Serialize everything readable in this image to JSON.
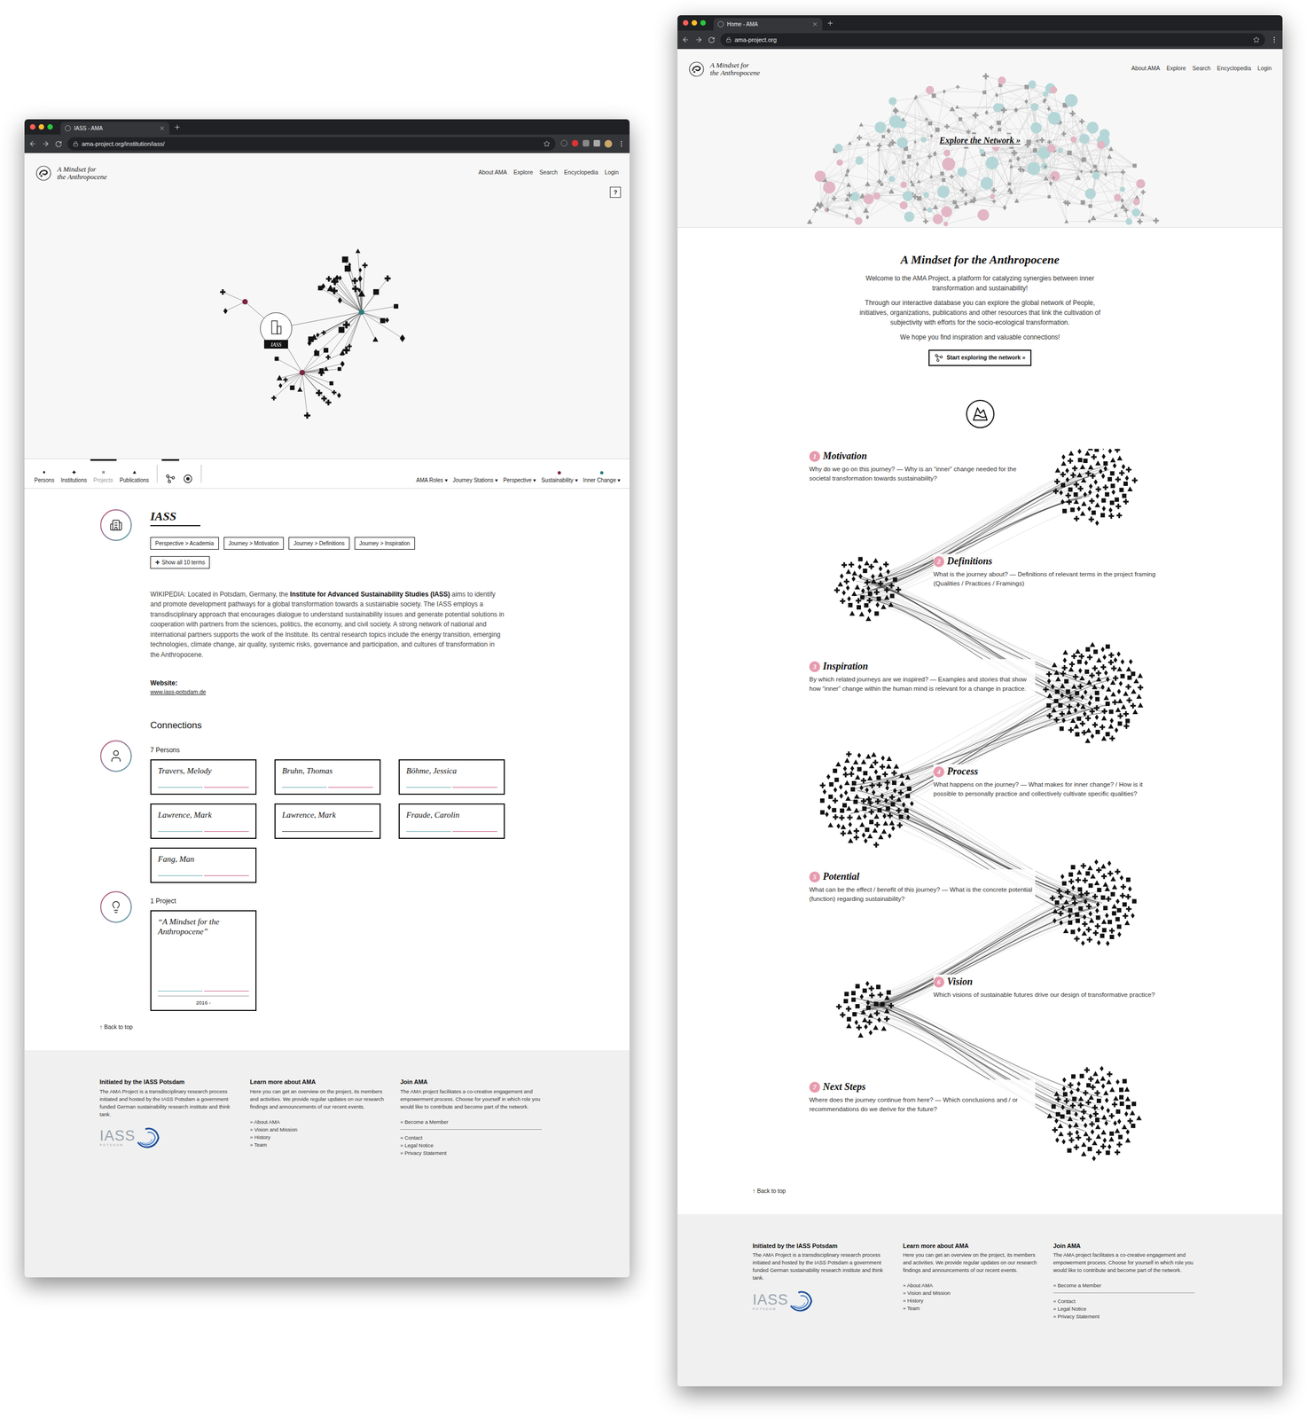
{
  "site": {
    "logo_lines": [
      "A Mindset for",
      "the Anthropocene"
    ],
    "nav": [
      "About AMA",
      "Explore",
      "Search",
      "Encyclopedia",
      "Login"
    ],
    "back_to_top": "↑ Back to top",
    "footer": {
      "columns": [
        {
          "heading": "Initiated by the IASS Potsdam",
          "text": "The AMA Project is a transdisciplinary research process initiated and hosted by the IASS Potsdam a government funded German sustainability research institute and think tank.",
          "links": [],
          "links_after_rule": []
        },
        {
          "heading": "Learn more about AMA",
          "text": "Here you can get an overview on the project, its members and activities. We provide regular updates on our research findings and announcements of our recent events.",
          "links": [
            "» About AMA",
            "» Vision and Mission",
            "» History",
            "» Team"
          ],
          "links_after_rule": []
        },
        {
          "heading": "Join AMA",
          "text": "The AMA project facilitates a co-creative engagement and empowerment process. Choose for yourself in which role you would like to contribute and become part of the network.",
          "links": [
            "» Become a Member"
          ],
          "links_after_rule": [
            "» Contact",
            "» Legal Notice",
            "» Privacy Statement"
          ]
        }
      ],
      "logo": {
        "name": "IASS",
        "sub": "POTSDAM"
      }
    }
  },
  "institution_window": {
    "tab_title": "IASS - AMA",
    "url": "ama-project.org/institution/iass/",
    "help_button": "?",
    "graph": {
      "center_label": "IASS"
    },
    "filters": [
      {
        "label": "Persons",
        "selected": false
      },
      {
        "label": "Institutions",
        "selected": false
      },
      {
        "label": "Projects",
        "selected": true
      },
      {
        "label": "Publications",
        "selected": false
      }
    ],
    "view_toggles": [
      {
        "selected": true
      },
      {
        "selected": false
      }
    ],
    "dropdowns": [
      {
        "label": "AMA Roles"
      },
      {
        "label": "Journey Stations"
      },
      {
        "label": "Perspective"
      },
      {
        "label": "Sustainability",
        "color": "#7a2342"
      },
      {
        "label": "Inner Change",
        "color": "#2b7b7e"
      }
    ],
    "caret": "▾",
    "title": "IASS",
    "tags": [
      "Perspective > Academia",
      "Journey > Motivation",
      "Journey > Definitions",
      "Journey > Inspiration"
    ],
    "show_all": {
      "icon": "✚",
      "label": "Show all 10 terms"
    },
    "description": {
      "before": "WIKIPEDIA: Located in Potsdam, Germany, the ",
      "bold": "Institute for Advanced Sustainability Studies (IASS)",
      "after": " aims to identify and promote development pathways for a global transformation towards a sustainable society. The IASS employs a transdisciplinary approach that encourages dialogue to understand sustainability issues and generate potential solutions in cooperation with partners from the sciences, politics, the economy, and civil society. A strong network of national and international partners supports the work of the Institute. Its central research topics include the energy transition, emerging technologies, climate change, air quality, systemic risks, governance and participation, and cultures of transformation in the Anthropocene."
    },
    "website": {
      "label": "Website:",
      "url": "www.iass-potsdam.de"
    },
    "connections_heading": "Connections",
    "persons": {
      "count_label": "7 Persons",
      "items": [
        {
          "name": "Travers, Melody",
          "lines": [
            "#5fa8ae",
            "#c8557f"
          ]
        },
        {
          "name": "Bruhn, Thomas",
          "lines": [
            "#5fa8ae",
            "#c8557f"
          ]
        },
        {
          "name": "Böhme, Jessica",
          "lines": [
            "#5fa8ae",
            "#c8557f"
          ]
        },
        {
          "name": "Lawrence, Mark",
          "lines": [
            "#5fa8ae",
            "#c8557f"
          ]
        },
        {
          "name": "Lawrence, Mark",
          "lines": [
            "#222222"
          ]
        },
        {
          "name": "Fraude, Carolin",
          "lines": [
            "#5fa8ae",
            "#c8557f"
          ]
        },
        {
          "name": "Fang, Man",
          "lines": [
            "#5fa8ae",
            "#c8557f"
          ]
        }
      ]
    },
    "projects": {
      "count_label": "1 Project",
      "items": [
        {
          "title": "“A Mindset for the Anthropocene”",
          "years": "2016 -",
          "lines": [
            "#5fa8ae",
            "#c8557f"
          ]
        }
      ]
    }
  },
  "home_window": {
    "tab_title": "Home - AMA",
    "url": "ama-project.org",
    "hero_link": "Explore the Network »",
    "title": "A Mindset for the Anthropocene",
    "paragraphs": [
      "Welcome to the AMA Project, a platform for catalyzing synergies between inner transformation and sustainability!",
      "Through our interactive database you can explore the global network of People, initiatives, organizations, publications and other resources that link the cultivation of subjectivity with efforts for the socio-ecological transformation.",
      "We hope you find inspiration and valuable connections!"
    ],
    "cta": "Start exploring the network »",
    "stations": [
      {
        "number": "1",
        "title": "Motivation",
        "text": "Why do we go on this journey? — Why is an “inner” change needed for the societal transformation towards sustainability?"
      },
      {
        "number": "2",
        "title": "Definitions",
        "text": "What is the journey about? — Definitions of relevant terms in the project framing (Qualities / Practices / Framings)"
      },
      {
        "number": "3",
        "title": "Inspiration",
        "text": "By which related journeys are we inspired? — Examples and stories that show how “inner” change within the human mind is relevant for a change in practice."
      },
      {
        "number": "4",
        "title": "Process",
        "text": "What happens on the journey? — What makes for inner change? / How is it possible to personally practice and collectively cultivate specific qualities?"
      },
      {
        "number": "5",
        "title": "Potential",
        "text": "What can be the effect / benefit of this journey? — What is the concrete potential (function) regarding sustainability?"
      },
      {
        "number": "6",
        "title": "Vision",
        "text": "Which visions of sustainable futures drive our design of transformative practice?"
      },
      {
        "number": "7",
        "title": "Next Steps",
        "text": "Where does the journey continue from here? — Which conclusions and / or recommendations do we derive for the future?"
      }
    ]
  }
}
